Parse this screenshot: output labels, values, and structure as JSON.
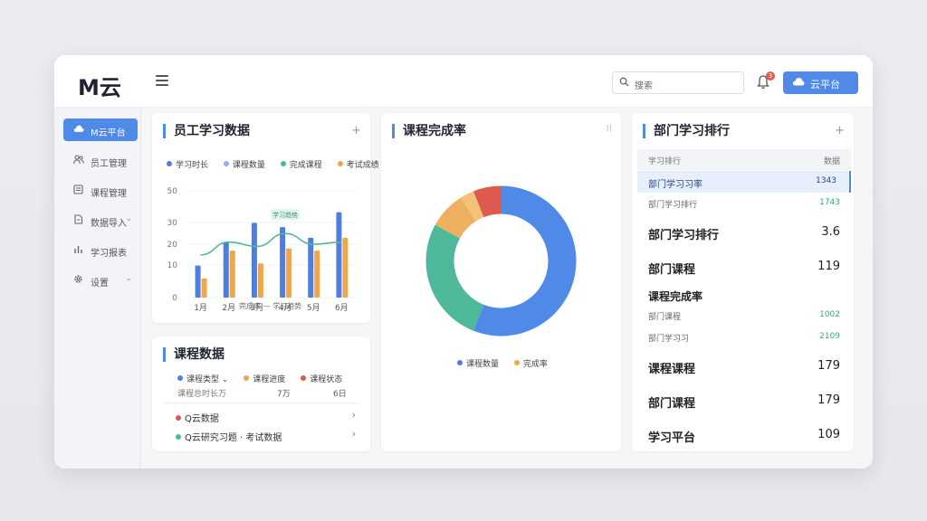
{
  "topbar": {
    "logo": "M云",
    "search_placeholder": "搜索",
    "notification_count": "3",
    "cloud_button_label": "云平台"
  },
  "sidebar": {
    "items": [
      {
        "label": "M云平台",
        "icon": "cloud-icon",
        "active": true
      },
      {
        "label": "员工管理",
        "icon": "users-icon"
      },
      {
        "label": "课程管理",
        "icon": "book-icon"
      },
      {
        "label": "数据导入",
        "icon": "import-icon",
        "has_chevron": true
      },
      {
        "label": "学习报表",
        "icon": "chart-icon"
      },
      {
        "label": "设置",
        "icon": "gear-icon",
        "has_chevron": true
      }
    ]
  },
  "staff_card": {
    "title": "员工学习数据",
    "legend": [
      {
        "label": "学习时长",
        "color": "#4f7fdb"
      },
      {
        "label": "课程数量",
        "color": "#8fb0ec"
      },
      {
        "label": "完成课程",
        "color": "#4fb89a"
      },
      {
        "label": "考试成绩",
        "color": "#f0a64a"
      }
    ],
    "bottom_legend": "完成率 — 学习趋势",
    "trend_label": "学习趋势"
  },
  "chart_data": {
    "type": "bar",
    "categories": [
      "1月",
      "2月",
      "3月",
      "4月",
      "5月",
      "6月"
    ],
    "ylim": [
      0,
      50
    ],
    "yticks": [
      "50",
      "30",
      "20",
      "10",
      "0"
    ],
    "series": [
      {
        "name": "学习时长",
        "color": "#4f7fdb",
        "values": [
          15,
          26,
          35,
          33,
          28,
          40
        ]
      },
      {
        "name": "考试成绩",
        "color": "#f0a64a",
        "values": [
          9,
          22,
          16,
          23,
          22,
          28
        ]
      },
      {
        "name": "完成率",
        "color": "#4fb89a",
        "type": "line",
        "values": [
          20,
          26,
          24,
          30,
          25,
          26
        ]
      }
    ]
  },
  "course_card": {
    "title": "课程数据",
    "filters": [
      "课程类型",
      "课程进度",
      "课程状态"
    ],
    "summary_label": "课程总时长万",
    "summary_values": [
      "7万",
      "6日"
    ],
    "items": [
      {
        "label": "Q云数据",
        "color": "#e0594f"
      },
      {
        "label": "Q云研究习题 · 考试数据",
        "color": "#4fb89a"
      }
    ]
  },
  "completion_card": {
    "title": "课程完成率",
    "legend": [
      {
        "label": "课程数量",
        "color": "#4f7fdb"
      },
      {
        "label": "完成率",
        "color": "#f0a64a"
      }
    ],
    "pie": [
      {
        "value": 56,
        "color": "#4f8ae8"
      },
      {
        "value": 27,
        "color": "#4fb89a"
      },
      {
        "value": 8,
        "color": "#eeb060"
      },
      {
        "value": 3,
        "color": "#f3c27a"
      },
      {
        "value": 6,
        "color": "#e0594f"
      }
    ]
  },
  "rank_card": {
    "title": "部门学习排行",
    "header": {
      "label": "学习排行",
      "value": "数据"
    },
    "rows": [
      {
        "label": "部门学习习率",
        "value": "1343",
        "style": "highlight"
      },
      {
        "label": "部门学习排行",
        "value": "1743",
        "style": "small-green"
      },
      {
        "label": "部门学习排行",
        "value": "3.6",
        "style": "big"
      },
      {
        "label": "部门课程",
        "value": "119",
        "style": "big"
      },
      {
        "label": "课程完成率",
        "value": "",
        "style": "section"
      },
      {
        "label": "部门课程",
        "value": "1002",
        "style": "small-green"
      },
      {
        "label": "部门学习习",
        "value": "2109",
        "style": "small-green"
      },
      {
        "label": "课程课程",
        "value": "179",
        "style": "big"
      },
      {
        "label": "部门课程",
        "value": "179",
        "style": "big"
      },
      {
        "label": "学习平台",
        "value": "109",
        "style": "big"
      }
    ]
  }
}
